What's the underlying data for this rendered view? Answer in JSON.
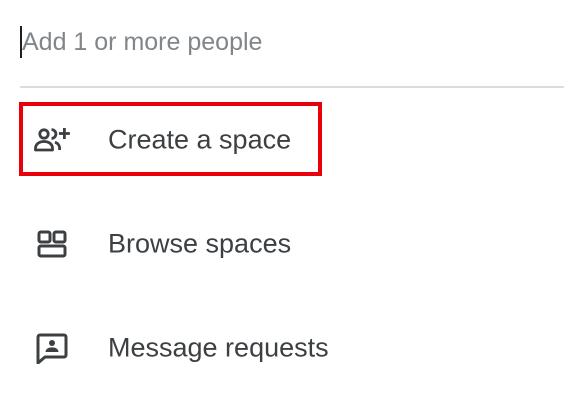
{
  "search": {
    "value": "",
    "placeholder": "Add 1 or more people"
  },
  "menu": {
    "items": [
      {
        "label": "Create a space",
        "icon": "group-add-icon",
        "highlighted": true
      },
      {
        "label": "Browse spaces",
        "icon": "browse-spaces-icon",
        "highlighted": false
      },
      {
        "label": "Message requests",
        "icon": "message-request-icon",
        "highlighted": false
      }
    ]
  },
  "colors": {
    "highlight": "#e8000b",
    "icon": "#3c4043",
    "text": "#3c4043",
    "placeholder": "#80868b",
    "divider": "#dadce0"
  }
}
